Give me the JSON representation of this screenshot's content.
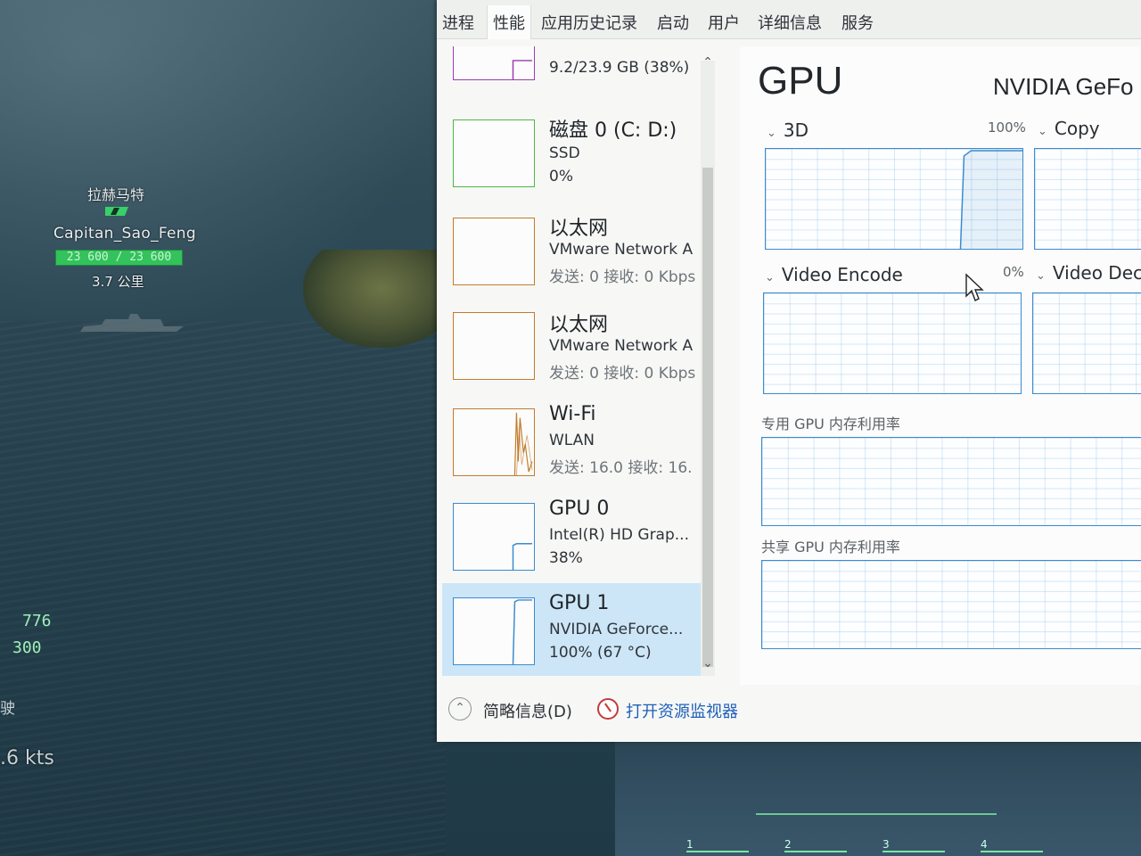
{
  "game": {
    "target_name": "拉赫马特",
    "player_name": "Capitan_Sao_Feng",
    "hp_text": "23 600 / 23 600",
    "distance": "3.7 公里",
    "stat_a": "776",
    "stat_b": "300",
    "stat_char": "驶",
    "speed": ".6 kts",
    "weapon_slots": [
      "1",
      "2",
      "3",
      "4"
    ]
  },
  "task_manager": {
    "tabs": [
      "进程",
      "性能",
      "应用历史记录",
      "启动",
      "用户",
      "详细信息",
      "服务"
    ],
    "active_tab": "性能",
    "sidebar": [
      {
        "title": "",
        "line1": "9.2/23.9 GB (38%)",
        "line2": "",
        "line3": "",
        "color": "#9b3bb5"
      },
      {
        "title": "磁盘 0 (C: D:)",
        "line1": "SSD",
        "line2": "0%",
        "line3": "",
        "color": "#4fb548"
      },
      {
        "title": "以太网",
        "line1": "VMware Network A",
        "line2": "发送: 0 接收: 0 Kbps",
        "line3": "",
        "color": "#c27b2c"
      },
      {
        "title": "以太网",
        "line1": "VMware Network A",
        "line2": "发送: 0 接收: 0 Kbps",
        "line3": "",
        "color": "#c27b2c"
      },
      {
        "title": "Wi-Fi",
        "line1": "WLAN",
        "line2": "发送: 16.0 接收: 16.",
        "line3": "",
        "color": "#c27b2c"
      },
      {
        "title": "GPU 0",
        "line1": "Intel(R) HD Grap...",
        "line2": "38%",
        "line3": "",
        "color": "#3b8ad0"
      },
      {
        "title": "GPU 1",
        "line1": "NVIDIA GeForce...",
        "line2": "100% (67 °C)",
        "line3": "",
        "color": "#3b8ad0"
      }
    ],
    "footer": {
      "fewer_details": "简略信息(D)",
      "open_monitor": "打开资源监视器"
    },
    "detail": {
      "title": "GPU",
      "gpu_name": "NVIDIA GeFo",
      "engines": [
        {
          "name": "3D",
          "percent": "100%"
        },
        {
          "name": "Copy",
          "percent": ""
        },
        {
          "name": "Video Encode",
          "percent": "0%"
        },
        {
          "name": "Video Dec",
          "percent": ""
        }
      ],
      "dedicated_memory_label": "专用 GPU 内存利用率",
      "shared_memory_label": "共享 GPU 内存利用率",
      "gpu_1_utilization": 1.0
    },
    "colors": {
      "gpu_graph": "#3b8ad0",
      "selected_bg": "#cce6f7",
      "link": "#1f5fb8"
    }
  }
}
